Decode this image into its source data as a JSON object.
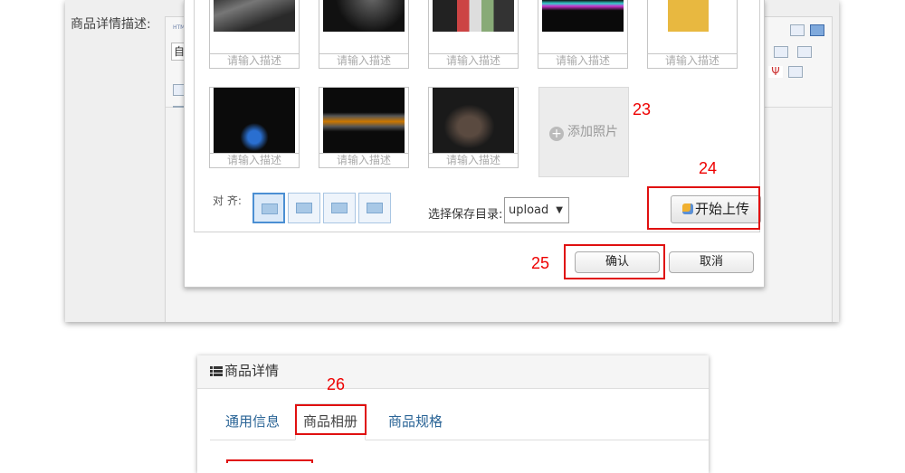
{
  "editor": {
    "field_label": "商品详情描述:",
    "html_tag": "HTML",
    "dropdown_char": "自"
  },
  "dialog": {
    "thumb_caption": "请输入描述",
    "add_photo_label": "添加照片",
    "align_label": "对 齐:",
    "save_dir_label": "选择保存目录:",
    "save_dir_value": "upload",
    "upload_button": "开始上传",
    "confirm_button": "确认",
    "cancel_button": "取消"
  },
  "annotations": {
    "n23": "23",
    "n24": "24",
    "n25": "25",
    "n26": "26"
  },
  "product_panel": {
    "title": "商品详情",
    "tabs": [
      "通用信息",
      "商品相册",
      "商品规格"
    ],
    "active_tab": "商品相册"
  },
  "colors": {
    "annotation_red": "#e01010",
    "tab_link": "#2a6496"
  }
}
